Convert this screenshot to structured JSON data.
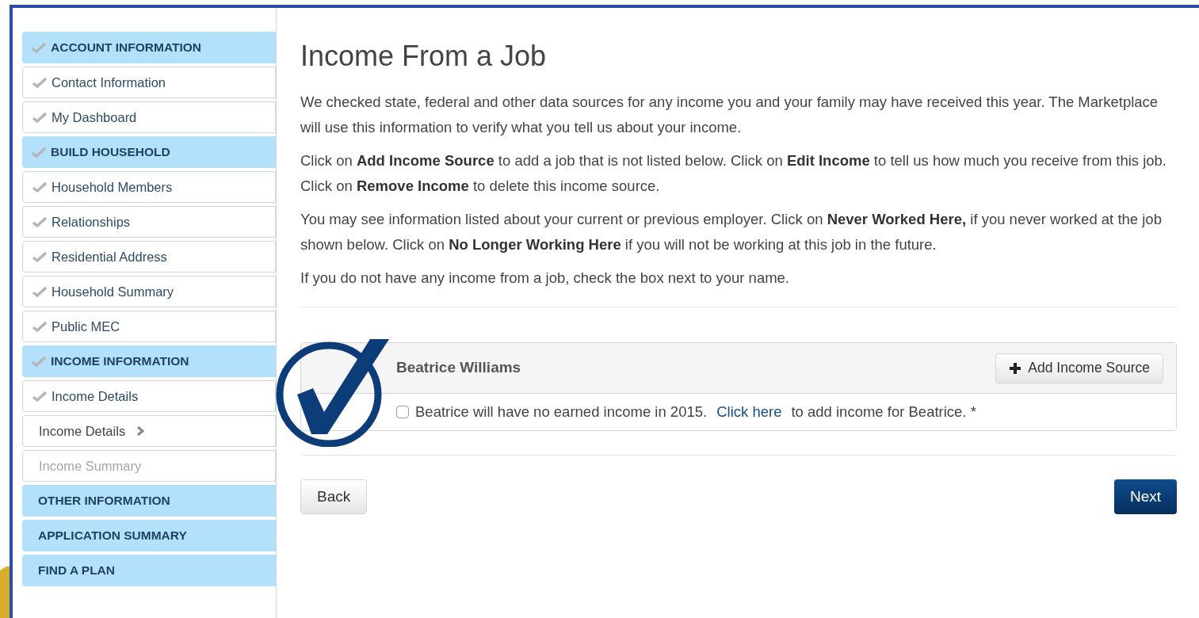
{
  "sidebar": {
    "items": [
      {
        "label": "ACCOUNT INFORMATION",
        "kind": "header",
        "checked": true
      },
      {
        "label": "Contact Information",
        "kind": "step",
        "checked": true
      },
      {
        "label": "My Dashboard",
        "kind": "step",
        "checked": true
      },
      {
        "label": "BUILD HOUSEHOLD",
        "kind": "header",
        "checked": true
      },
      {
        "label": "Household Members",
        "kind": "step",
        "checked": true
      },
      {
        "label": "Relationships",
        "kind": "step",
        "checked": true
      },
      {
        "label": "Residential Address",
        "kind": "step",
        "checked": true
      },
      {
        "label": "Household Summary",
        "kind": "step",
        "checked": true
      },
      {
        "label": "Public MEC",
        "kind": "step",
        "checked": true
      },
      {
        "label": "INCOME INFORMATION",
        "kind": "header",
        "checked": true
      },
      {
        "label": "Income Details",
        "kind": "step",
        "checked": true
      },
      {
        "label": "Income Details",
        "kind": "current",
        "checked": false
      },
      {
        "label": "Income Summary",
        "kind": "pending",
        "checked": false
      },
      {
        "label": "OTHER INFORMATION",
        "kind": "header",
        "checked": false
      },
      {
        "label": "APPLICATION SUMMARY",
        "kind": "header",
        "checked": false
      },
      {
        "label": "FIND A PLAN",
        "kind": "header",
        "checked": false
      }
    ]
  },
  "main": {
    "title": "Income From a Job",
    "paragraphs": [
      "We checked state, federal and other data sources for any income you and your family may have received this year. The Marketplace will use this information to verify what you tell us about your income.",
      "Click on **Add Income Source** to add a job that is not listed below. Click on **Edit Income** to tell us how much you receive from this job. Click on **Remove Income** to delete this income source.",
      "You may see information listed about your current or previous employer. Click on **Never Worked Here,** if you never worked at the job shown below. Click on **No Longer Working Here** if you will not be working at this job in the future.",
      "If you do not have any income from a job, check the box next to your name."
    ],
    "person": {
      "name": "Beatrice Williams",
      "add_button": "Add Income Source",
      "no_income_checked": false,
      "no_income_text": "Beatrice will have no earned income in 2015.",
      "link": "Click here",
      "after_link": "to add income for Beatrice. *"
    },
    "back_button": "Back",
    "next_button": "Next"
  }
}
